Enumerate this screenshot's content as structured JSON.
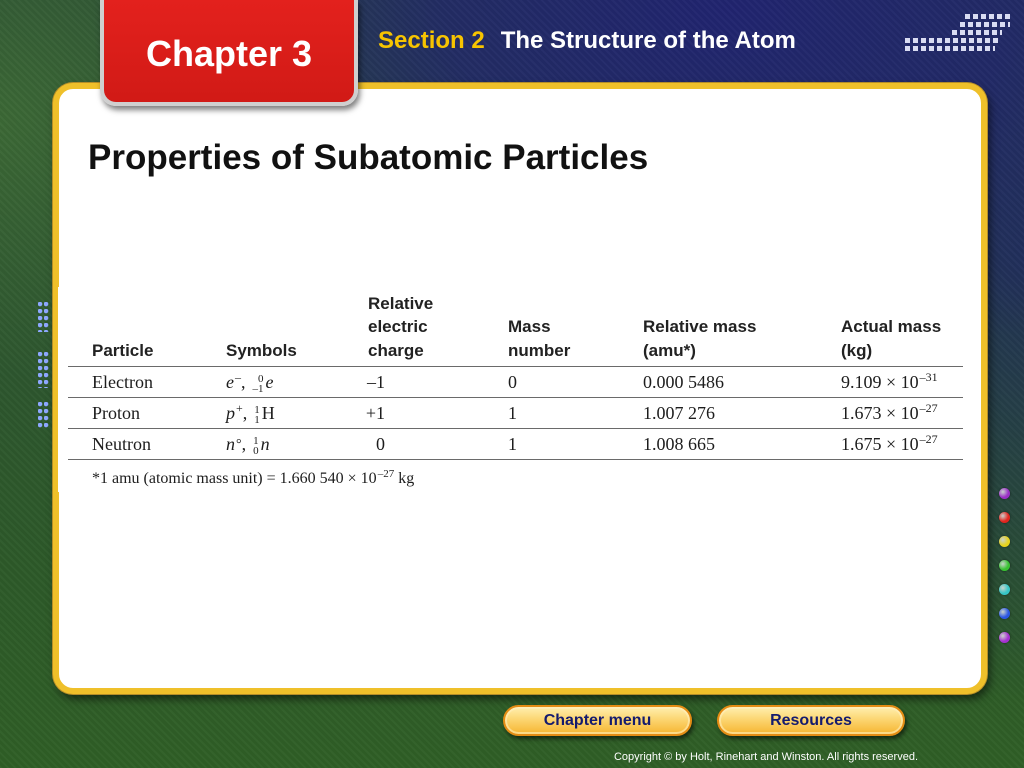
{
  "header": {
    "chapter_tab": "Chapter 3",
    "section_number": "Section 2",
    "section_title": "The Structure of the Atom"
  },
  "slide": {
    "title": "Properties of Subatomic Particles"
  },
  "table": {
    "headers": {
      "particle": [
        "Particle"
      ],
      "symbols": [
        "Symbols"
      ],
      "relative_charge": [
        "Relative",
        "electric",
        "charge"
      ],
      "mass_number": [
        "Mass",
        "number"
      ],
      "relative_mass": [
        "Relative mass",
        "(amu*)"
      ],
      "actual_mass": [
        "Actual mass",
        "(kg)"
      ]
    },
    "rows": [
      {
        "particle": "Electron",
        "symbols": {
          "letter": "e",
          "charge_mark": "–",
          "separator": ",",
          "mass_number": "0",
          "atomic_number": "–1",
          "nuclide": "e"
        },
        "relative_charge": "–1",
        "mass_number": "0",
        "relative_mass": "0.000 5486",
        "actual_mass": {
          "coefficient": "9.109 × 10",
          "exponent": "–31"
        }
      },
      {
        "particle": "Proton",
        "symbols": {
          "letter": "p",
          "charge_mark": "+",
          "separator": ",",
          "mass_number": "1",
          "atomic_number": "1",
          "nuclide": "H"
        },
        "relative_charge": "+1",
        "mass_number": "1",
        "relative_mass": "1.007 276",
        "actual_mass": {
          "coefficient": "1.673 × 10",
          "exponent": "–27"
        }
      },
      {
        "particle": "Neutron",
        "symbols": {
          "letter": "n",
          "charge_mark": "°",
          "separator": ",",
          "mass_number": "1",
          "atomic_number": "0",
          "nuclide": "n"
        },
        "relative_charge": "0",
        "mass_number": "1",
        "relative_mass": "1.008 665",
        "actual_mass": {
          "coefficient": "1.675 × 10",
          "exponent": "–27"
        }
      }
    ],
    "footnote": {
      "text": "*1 amu (atomic mass unit) = 1.660 540 × 10",
      "exponent": "–27",
      "unit": "kg"
    }
  },
  "nav": {
    "chapter_menu": "Chapter menu",
    "resources": "Resources"
  },
  "footer": {
    "copyright": "Copyright © by Holt, Rinehart and Winston. All rights reserved."
  },
  "colors": {
    "chapter_tab": "#e3211d",
    "section_number": "#f7c400",
    "panel_border": "#efc02a",
    "button_text": "#141b6e",
    "button_border": "#e48c14"
  },
  "decor": {
    "side_dot_colors": [
      "#9a2fc6",
      "#e2251e",
      "#e6d21c",
      "#39c232",
      "#36c6c6",
      "#2b56e4",
      "#a530d0"
    ]
  }
}
